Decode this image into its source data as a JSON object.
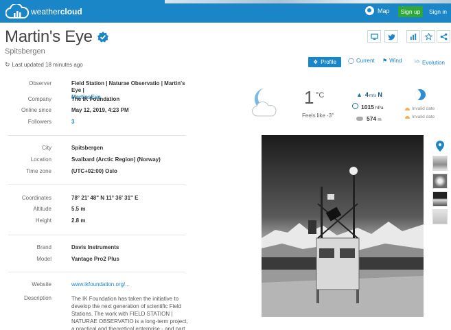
{
  "header": {
    "brand_light": "weather",
    "brand_bold": "cloud",
    "map_label": "Map",
    "signup_label": "Sign up",
    "signin_label": "Sign in",
    "accent": "#1a86c8",
    "signup_color": "#2fa83a"
  },
  "station": {
    "name": "Martin's Eye",
    "location": "Spitsbergen",
    "last_updated": "Last updated 18 minutes ago"
  },
  "tabs": {
    "profile": "Profile",
    "current": "Current",
    "wind": "Wind",
    "evolution": "Evolution"
  },
  "info": {
    "observer_label": "Observer",
    "observer_value": "Field Station | Naturae Observatio | Martin's Eye |",
    "observer_link": "MartinsEye",
    "company_label": "Company",
    "company_value": "The IK Foundation",
    "online_label": "Online since",
    "online_value": "May 12, 2019, 4:23 PM",
    "followers_label": "Followers",
    "followers_value": "3",
    "city_label": "City",
    "city_value": "Spitsbergen",
    "loc_label": "Location",
    "loc_value": "Svalbard (Arctic Region) (Norway)",
    "tz_label": "Time zone",
    "tz_value": "(UTC+02:00) Oslo",
    "coord_label": "Coordinates",
    "coord_value": "78° 21' 48\" N  11° 36' 31\" E",
    "alt_label": "Altitude",
    "alt_value": "5.5 m",
    "height_label": "Height",
    "height_value": "2.8 m",
    "brand_label": "Brand",
    "brand_value": "Davis Instruments",
    "model_label": "Model",
    "model_value": "Vantage Pro2 Plus",
    "web_label": "Website",
    "web_value": "www.ikfoundation.org/...",
    "desc_label": "Description",
    "desc_value": "The IK Foundation has taken the initiative to develop the next generation of scientific Field Stations. The work with FIELD STATION | NATURAE OBSERVATIO is a long-term project, a practical and theoretical enterprise - and part of"
  },
  "weather": {
    "temp": "1",
    "temp_unit": "°C",
    "feels_like": "Feels like -3°",
    "wind_value": "4",
    "wind_unit": "m/s",
    "wind_dir": "N",
    "pressure_value": "1015",
    "pressure_unit": "hPa",
    "cloudbase_value": "574",
    "cloudbase_unit": "m",
    "sunrise_text": "Invalid date",
    "sunset_text": "Invalid date"
  },
  "icons": {
    "monitor": "monitor-icon",
    "twitter": "twitter-icon",
    "chart": "bar-chart-icon",
    "star": "star-icon",
    "share": "share-icon"
  }
}
